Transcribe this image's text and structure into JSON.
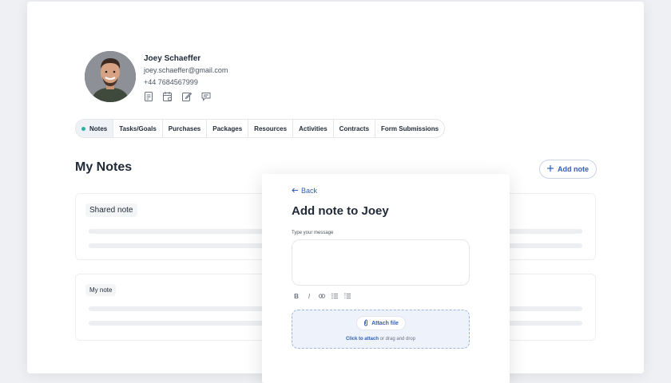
{
  "profile": {
    "name": "Joey Schaeffer",
    "email": "joey.schaeffer@gmail.com",
    "phone": "+44 7684567999"
  },
  "tabs": [
    {
      "label": "Notes",
      "active": true
    },
    {
      "label": "Tasks/Goals",
      "active": false
    },
    {
      "label": "Purchases",
      "active": false
    },
    {
      "label": "Packages",
      "active": false
    },
    {
      "label": "Resources",
      "active": false
    },
    {
      "label": "Activities",
      "active": false
    },
    {
      "label": "Contracts",
      "active": false
    },
    {
      "label": "Form Submissions",
      "active": false
    }
  ],
  "notes": {
    "title": "My Notes",
    "add_label": "Add note",
    "items": [
      {
        "label": "Shared note"
      },
      {
        "label": "My note"
      }
    ]
  },
  "modal": {
    "back_label": "Back",
    "title": "Add note to Joey",
    "field_label": "Type your message",
    "attach_label": "Attach file",
    "drop_link": "Click to attach",
    "drop_text": " or drag and drop"
  },
  "colors": {
    "accent": "#2f5fb3",
    "active_dot": "#2bb3a3",
    "dropzone_bg": "#edf2fb"
  },
  "icons": {
    "profile_actions": [
      "document-icon",
      "calendar-icon",
      "edit-icon",
      "chat-icon"
    ],
    "toolbar": [
      "bold-icon",
      "italic-icon",
      "link-icon",
      "bullet-list-icon",
      "numbered-list-icon"
    ]
  }
}
